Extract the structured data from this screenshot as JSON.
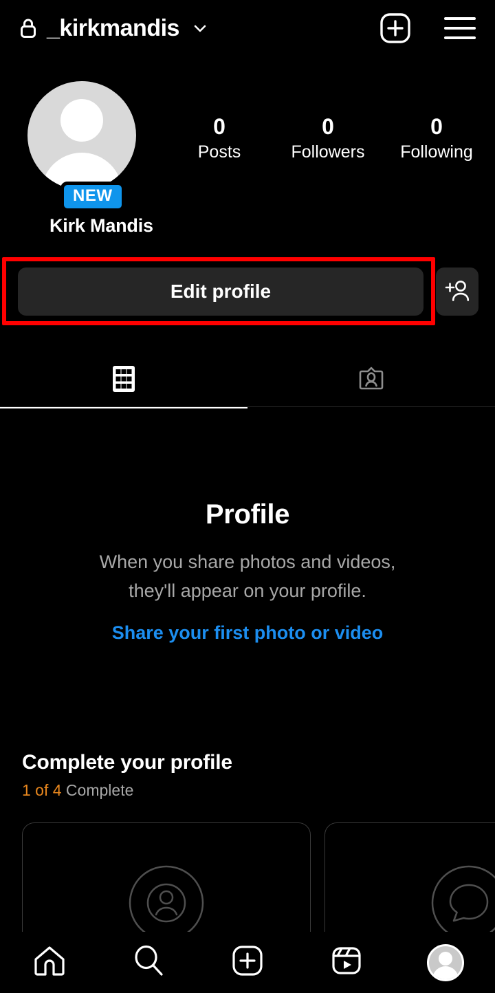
{
  "header": {
    "lock_icon": "lock-icon",
    "username": "_kirkmandis",
    "chevron_icon": "chevron-down-icon",
    "create_icon": "plus-box-icon",
    "menu_icon": "hamburger-menu-icon"
  },
  "profile": {
    "avatar": "default-avatar",
    "new_badge": "NEW",
    "display_name": "Kirk Mandis",
    "stats": [
      {
        "value": "0",
        "label": "Posts"
      },
      {
        "value": "0",
        "label": "Followers"
      },
      {
        "value": "0",
        "label": "Following"
      }
    ]
  },
  "actions": {
    "edit_profile_label": "Edit profile",
    "add_person_icon": "add-person-icon",
    "highlight_color": "#ff0000"
  },
  "tabs": [
    {
      "name": "grid-tab",
      "icon": "grid-icon",
      "active": true
    },
    {
      "name": "tagged-tab",
      "icon": "tagged-person-icon",
      "active": false
    }
  ],
  "empty_state": {
    "title": "Profile",
    "line1": "When you share photos and videos,",
    "line2": "they'll appear on your profile.",
    "link": "Share your first photo or video",
    "link_color": "#1c8ef0"
  },
  "complete_profile": {
    "title": "Complete your profile",
    "progress_count": "1 of 4",
    "progress_suffix": " Complete",
    "progress_color": "#e8871e",
    "cards": [
      {
        "icon": "person-circle-icon"
      },
      {
        "icon": "chat-bubble-circle-icon"
      }
    ]
  },
  "bottom_nav": [
    {
      "name": "nav-home",
      "icon": "home-icon",
      "active": false
    },
    {
      "name": "nav-search",
      "icon": "search-icon",
      "active": false
    },
    {
      "name": "nav-create",
      "icon": "plus-box-icon",
      "active": false
    },
    {
      "name": "nav-reels",
      "icon": "reels-icon",
      "active": false
    },
    {
      "name": "nav-profile",
      "icon": "avatar-icon",
      "active": true
    }
  ]
}
